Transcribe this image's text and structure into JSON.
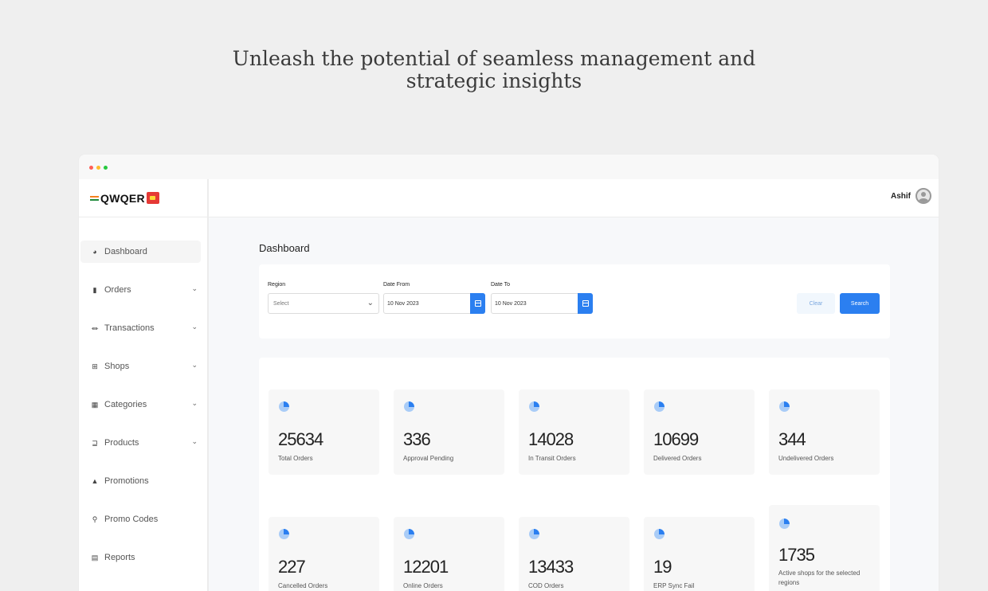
{
  "headline": {
    "line1": "Unleash the potential of seamless management and",
    "line2": "strategic insights"
  },
  "brand": {
    "name": "QWQER"
  },
  "user": {
    "name": "Ashif"
  },
  "sidebar": {
    "items": [
      {
        "label": "Dashboard",
        "icon": "pie-chart-icon",
        "active": true,
        "expandable": false
      },
      {
        "label": "Orders",
        "icon": "orders-icon",
        "active": false,
        "expandable": true
      },
      {
        "label": "Transactions",
        "icon": "bank-icon",
        "active": false,
        "expandable": true
      },
      {
        "label": "Shops",
        "icon": "shop-icon",
        "active": false,
        "expandable": true
      },
      {
        "label": "Categories",
        "icon": "grid-icon",
        "active": false,
        "expandable": true
      },
      {
        "label": "Products",
        "icon": "cart-icon",
        "active": false,
        "expandable": true
      },
      {
        "label": "Promotions",
        "icon": "flask-icon",
        "active": false,
        "expandable": false
      },
      {
        "label": "Promo Codes",
        "icon": "tag-icon",
        "active": false,
        "expandable": false
      },
      {
        "label": "Reports",
        "icon": "report-icon",
        "active": false,
        "expandable": false
      }
    ]
  },
  "page": {
    "title": "Dashboard"
  },
  "filters": {
    "region_label": "Region",
    "region_value": "Select",
    "date_from_label": "Date From",
    "date_from_value": "10 Nov 2023",
    "date_to_label": "Date To",
    "date_to_value": "10 Nov 2023",
    "clear_label": "Clear",
    "search_label": "Search"
  },
  "stats": [
    {
      "value": "25634",
      "label": "Total Orders"
    },
    {
      "value": "336",
      "label": "Approval Pending"
    },
    {
      "value": "14028",
      "label": "In Transit Orders"
    },
    {
      "value": "10699",
      "label": "Delivered Orders"
    },
    {
      "value": "344",
      "label": "Undelivered Orders"
    },
    {
      "value": "227",
      "label": "Cancelled Orders"
    },
    {
      "value": "12201",
      "label": "Online Orders"
    },
    {
      "value": "13433",
      "label": "COD Orders"
    },
    {
      "value": "19",
      "label": "ERP Sync Fail"
    },
    {
      "value": "1735",
      "label": "Active shops for the selected regions"
    }
  ],
  "colors": {
    "accent": "#2b7ff0",
    "background": "#efefef"
  }
}
